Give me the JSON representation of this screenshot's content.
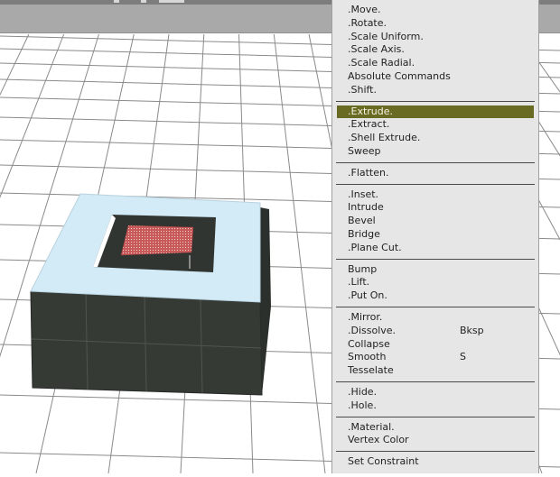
{
  "menu": {
    "groups": [
      {
        "items": [
          {
            "label": ".Move."
          },
          {
            "label": ".Rotate."
          },
          {
            "label": ".Scale Uniform."
          },
          {
            "label": ".Scale Axis."
          },
          {
            "label": ".Scale Radial."
          },
          {
            "label": "Absolute Commands"
          },
          {
            "label": ".Shift."
          }
        ]
      },
      {
        "items": [
          {
            "label": ".Extrude.",
            "highlighted": true
          },
          {
            "label": ".Extract."
          },
          {
            "label": ".Shell Extrude."
          },
          {
            "label": "Sweep"
          }
        ]
      },
      {
        "items": [
          {
            "label": ".Flatten."
          }
        ]
      },
      {
        "items": [
          {
            "label": ".Inset."
          },
          {
            "label": "Intrude"
          },
          {
            "label": "Bevel"
          },
          {
            "label": "Bridge"
          },
          {
            "label": ".Plane Cut."
          }
        ]
      },
      {
        "items": [
          {
            "label": "Bump"
          },
          {
            "label": ".Lift."
          },
          {
            "label": ".Put On."
          }
        ]
      },
      {
        "items": [
          {
            "label": ".Mirror."
          },
          {
            "label": ".Dissolve.",
            "hotkey": "Bksp"
          },
          {
            "label": "Collapse"
          },
          {
            "label": "Smooth",
            "hotkey": "S"
          },
          {
            "label": "Tesselate"
          }
        ]
      },
      {
        "items": [
          {
            "label": ".Hide."
          },
          {
            "label": ".Hole."
          }
        ]
      },
      {
        "items": [
          {
            "label": ".Material."
          },
          {
            "label": "Vertex Color"
          }
        ]
      },
      {
        "items": [
          {
            "label": "Set Constraint"
          }
        ]
      }
    ]
  },
  "colors": {
    "grid_line": "#8a8a8a",
    "top_face": "#d3ebf6",
    "side_faces": "#353a35",
    "hole_interior": "#303532",
    "selected_face": "#c95a5a",
    "menu_bg": "#e6e6e6",
    "menu_highlight": "#6a6b22"
  },
  "icons": [
    "toolbar-icon",
    "toolbar-icon",
    "toolbar-icon"
  ]
}
